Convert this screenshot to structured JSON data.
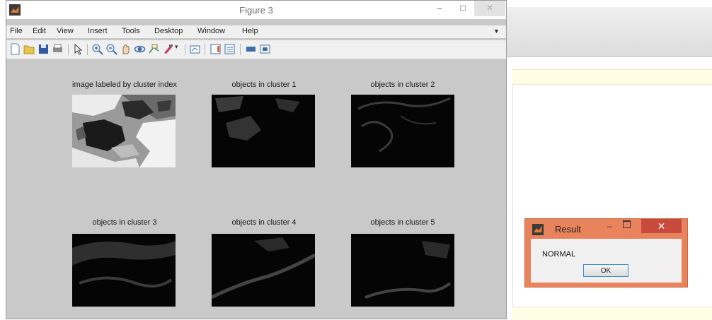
{
  "figure": {
    "title": "Figure 3",
    "menu": [
      "File",
      "Edit",
      "View",
      "Insert",
      "Tools",
      "Desktop",
      "Window",
      "Help"
    ],
    "toolbar_icons": [
      "new-figure-icon",
      "open-file-icon",
      "save-icon",
      "print-icon",
      "edit-plot-icon",
      "zoom-in-icon",
      "zoom-out-icon",
      "pan-icon",
      "rotate-3d-icon",
      "data-cursor-icon",
      "brush-icon",
      "link-plot-icon",
      "colorbar-icon",
      "legend-icon",
      "hide-plot-tools-icon",
      "show-plot-tools-icon"
    ],
    "plots": [
      {
        "title": "image labeled by cluster index"
      },
      {
        "title": "objects in cluster 1"
      },
      {
        "title": "objects in cluster 2"
      },
      {
        "title": "objects in cluster 3"
      },
      {
        "title": "objects in cluster 4"
      },
      {
        "title": "objects in cluster 5"
      }
    ]
  },
  "dialog": {
    "title": "Result",
    "message": "NORMAL",
    "ok_label": "OK"
  },
  "colors": {
    "figure_bg": "#c9c9c9",
    "dialog_border": "#e8835c",
    "dialog_close": "#c74a3c"
  }
}
